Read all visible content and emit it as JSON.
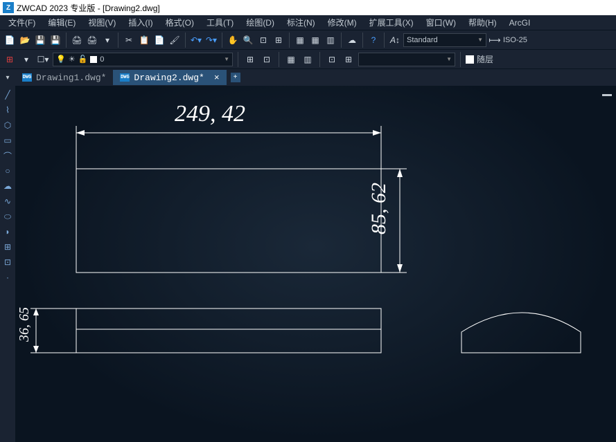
{
  "title": "ZWCAD 2023 专业版 - [Drawing2.dwg]",
  "menu": {
    "file": "文件(F)",
    "edit": "编辑(E)",
    "view": "视图(V)",
    "insert": "插入(I)",
    "format": "格式(O)",
    "tool": "工具(T)",
    "draw": "绘图(D)",
    "annotate": "标注(N)",
    "modify": "修改(M)",
    "extend": "扩展工具(X)",
    "window": "窗口(W)",
    "help": "帮助(H)",
    "arcgis": "ArcGI"
  },
  "style_dropdown": "Standard",
  "dimstyle_dropdown": "ISO-25",
  "layer_color_0": "0",
  "layer_follow": "随层",
  "tabs": {
    "t1": "Drawing1.dwg*",
    "t2": "Drawing2.dwg*"
  },
  "dims": {
    "width": "249, 42",
    "height": "85, 62",
    "small": "36, 65"
  }
}
